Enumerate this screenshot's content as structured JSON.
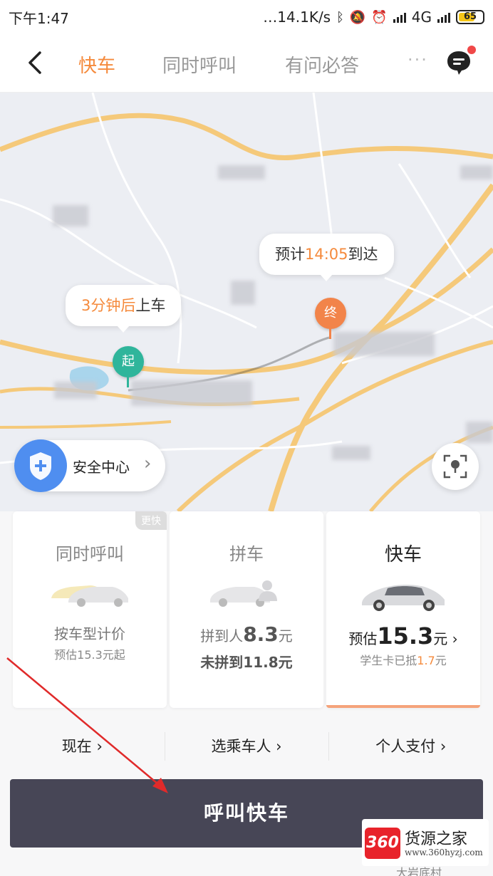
{
  "status_bar": {
    "time": "下午1:47",
    "network_speed": "…14.1K/s",
    "network_type": "4G",
    "battery": "65"
  },
  "nav": {
    "tabs": [
      {
        "label": "快车",
        "active": true
      },
      {
        "label": "同时呼叫",
        "active": false
      },
      {
        "label": "有问必答",
        "active": false
      }
    ],
    "more": "···",
    "has_unread": true
  },
  "map": {
    "pickup_bubble_hl": "3分钟后",
    "pickup_bubble_rest": "上车",
    "arrive_bubble_pre": "预计",
    "arrive_bubble_time": "14:05",
    "arrive_bubble_post": "到达",
    "start_pin": "起",
    "end_pin": "终",
    "safety_center": "安全中心",
    "colors": {
      "road": "#f5c26b",
      "start": "#2fb59b",
      "end": "#f2844a"
    }
  },
  "cards": [
    {
      "title": "同时呼叫",
      "tag": "更快",
      "line1": "按车型计价",
      "line2": "预估15.3元起"
    },
    {
      "title": "拼车",
      "line1_pre": "拼到人",
      "line1_price": "8.3",
      "line1_unit": "元",
      "line2": "未拼到11.8元"
    },
    {
      "title": "快车",
      "price_pre": "预估",
      "price": "15.3",
      "price_unit": "元",
      "discount_pre": "学生卡已抵",
      "discount_value": "1.7",
      "discount_unit": "元",
      "selected": true
    }
  ],
  "options": [
    {
      "label": "现在"
    },
    {
      "label": "选乘车人"
    },
    {
      "label": "个人支付"
    }
  ],
  "call_button": "呼叫快车",
  "watermark": {
    "badge": "360",
    "text": "货源之家",
    "url": "www.360hyzj.com"
  },
  "bottom_faint": "大岩底村"
}
